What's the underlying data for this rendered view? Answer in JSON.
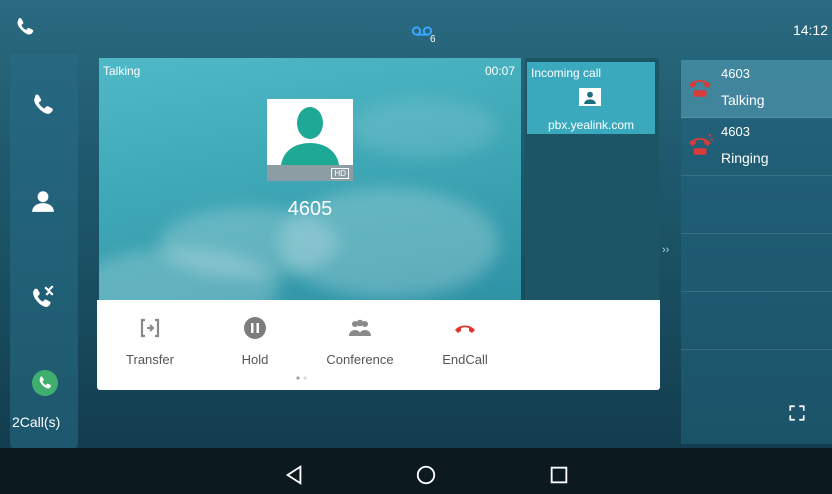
{
  "status_bar": {
    "time": "14:12",
    "voicemail_count": "6"
  },
  "sidebar": {
    "items": [
      {
        "icon": "phone-icon"
      },
      {
        "icon": "contacts-icon"
      },
      {
        "icon": "call-history-icon"
      }
    ],
    "calls_count_label": "2Call(s)"
  },
  "active_call": {
    "status": "Talking",
    "timer": "00:07",
    "number": "4605",
    "hd_badge": "HD"
  },
  "incoming_call": {
    "label": "Incoming call",
    "host": "pbx.yealink.com"
  },
  "softkeys": [
    {
      "label": "Transfer",
      "icon": "transfer-icon"
    },
    {
      "label": "Hold",
      "icon": "hold-icon"
    },
    {
      "label": "Conference",
      "icon": "conference-icon"
    },
    {
      "label": "EndCall",
      "icon": "end-call-icon",
      "color": "#e3342f"
    }
  ],
  "call_list": [
    {
      "number": "4603",
      "status": "Talking",
      "icon": "call-active-icon"
    },
    {
      "number": "4603",
      "status": "Ringing",
      "icon": "call-ringing-icon"
    }
  ],
  "colors": {
    "accent": "#3aa9bd",
    "end_call": "#e3342f",
    "call_active": "#d93a3a",
    "calls_badge": "#3fae6e"
  }
}
